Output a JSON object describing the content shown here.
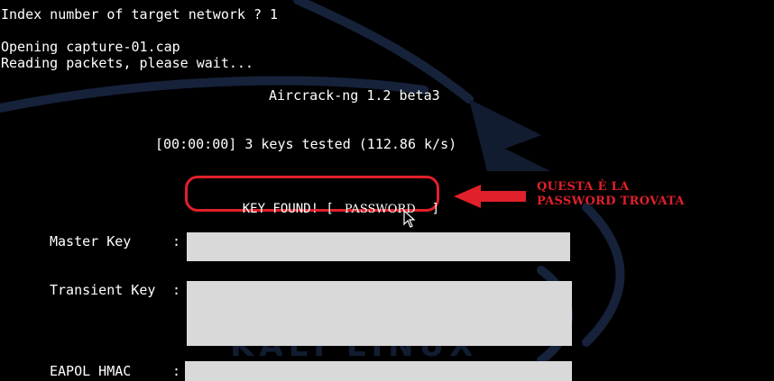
{
  "terminal": {
    "index_prompt": "Index number of target network ? 1",
    "opening_line": "Opening capture-01.cap",
    "reading_line": "Reading packets, please wait...",
    "aircrack_title": "Aircrack-ng 1.2 beta3",
    "keys_tested": "[00:00:00] 3 keys tested (112.86 k/s)",
    "key_found_prefix": "KEY FOUND! [",
    "key_found_password": "PASSWORD",
    "key_found_suffix": "]",
    "master_key_label": "Master Key",
    "transient_key_label": "Transient Key",
    "eapol_hmac_label": "EAPOL HMAC",
    "separator": ":"
  },
  "annotation": {
    "line1": "QUESTA È LA",
    "line2": "PASSWORD TROVATA"
  },
  "colors": {
    "background": "#000000",
    "text": "#ffffff",
    "highlight_red": "#e0202a",
    "redaction_gray": "#d9d9d9"
  },
  "icons": {
    "cursor": "mouse-pointer-icon",
    "arrow": "left-arrow-icon",
    "wallpaper": "kali-dragon-logo"
  }
}
